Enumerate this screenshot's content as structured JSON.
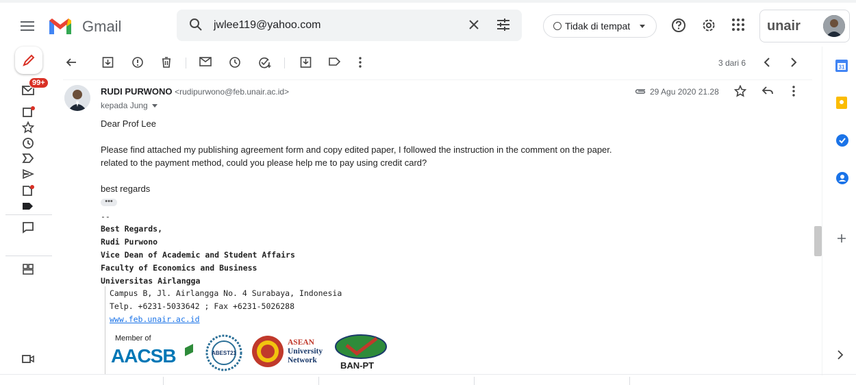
{
  "app": {
    "name": "Gmail"
  },
  "search": {
    "value": "jwlee119@yahoo.com"
  },
  "status": {
    "label": "Tidak di tempat"
  },
  "rail": {
    "unread_badge": "99+"
  },
  "toolbar": {
    "pagination": "3 dari 6"
  },
  "message": {
    "sender_name": "RUDI PURWONO",
    "sender_email": "<rudipurwono@feb.unair.ac.id>",
    "to": "kepada Jung",
    "date": "29 Agu 2020 21.28",
    "greeting": "Dear Prof Lee",
    "line1": "Please find attached my publishing agreement form and copy edited paper, I followed the instruction in the comment on the paper.",
    "line2": "related to the payment method, could you please help me to pay using credit card?",
    "closing": "best regards",
    "ellipsis": "•••"
  },
  "signature": {
    "sep": "--",
    "regards": "Best Regards,",
    "name": "Rudi Purwono",
    "title": "Vice Dean of Academic and Student Affairs",
    "faculty": "Faculty of Economics and Business",
    "university": "Universitas Airlangga",
    "address": "Campus B, Jl. Airlangga No. 4 Surabaya, Indonesia",
    "phone": "Telp. +6231-5033642 ; Fax +6231-5026288",
    "website": "www.feb.unair.ac.id",
    "member_of": "Member of",
    "aacsb": "AACSB",
    "abest": "ABEST21",
    "asean_1": "ASEAN",
    "asean_2": "University",
    "asean_3": "Network",
    "banpt": "BAN-PT"
  },
  "account": {
    "logo_text": "unair"
  },
  "colors": {
    "accent": "#1a73e8",
    "badge": "#d93025",
    "gmail_red": "#ea4335"
  }
}
